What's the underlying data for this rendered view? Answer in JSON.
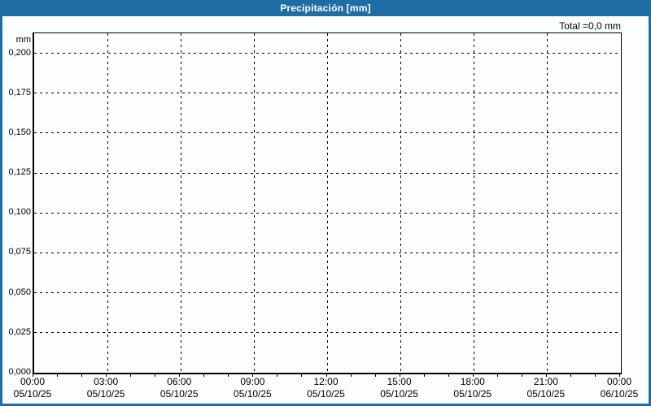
{
  "window": {
    "title": "Precipitación [mm]",
    "total_label": "Total =0,0 mm"
  },
  "colors": {
    "titlebar": "#1f6da5",
    "window_border": "#1f6da5",
    "background": "#fcfdfd",
    "title_text": "#ffffff",
    "grid": "#000000",
    "text": "#000000"
  },
  "chart_data": {
    "type": "bar",
    "title": "Precipitación [mm]",
    "ylabel": "mm",
    "xlabel": "",
    "grid": true,
    "ylim": [
      0,
      0.2125
    ],
    "x_range_hours": 24,
    "y_ticks": [
      {
        "label": "0,200",
        "value": 0.2
      },
      {
        "label": "0,175",
        "value": 0.175
      },
      {
        "label": "0,150",
        "value": 0.15
      },
      {
        "label": "0,125",
        "value": 0.125
      },
      {
        "label": "0,100",
        "value": 0.1
      },
      {
        "label": "0,075",
        "value": 0.075
      },
      {
        "label": "0,050",
        "value": 0.05
      },
      {
        "label": "0,025",
        "value": 0.025
      },
      {
        "label": "0,000",
        "value": 0.0
      }
    ],
    "x_ticks": [
      {
        "time": "00:00",
        "date": "05/10/25",
        "hour": 0
      },
      {
        "time": "03:00",
        "date": "05/10/25",
        "hour": 3
      },
      {
        "time": "06:00",
        "date": "05/10/25",
        "hour": 6
      },
      {
        "time": "09:00",
        "date": "05/10/25",
        "hour": 9
      },
      {
        "time": "12:00",
        "date": "05/10/25",
        "hour": 12
      },
      {
        "time": "15:00",
        "date": "05/10/25",
        "hour": 15
      },
      {
        "time": "18:00",
        "date": "05/10/25",
        "hour": 18
      },
      {
        "time": "21:00",
        "date": "05/10/25",
        "hour": 21
      },
      {
        "time": "00:00",
        "date": "06/10/25",
        "hour": 24
      }
    ],
    "minor_tick_every_hours": 1,
    "series": [],
    "values": [],
    "total": "0,0 mm"
  }
}
